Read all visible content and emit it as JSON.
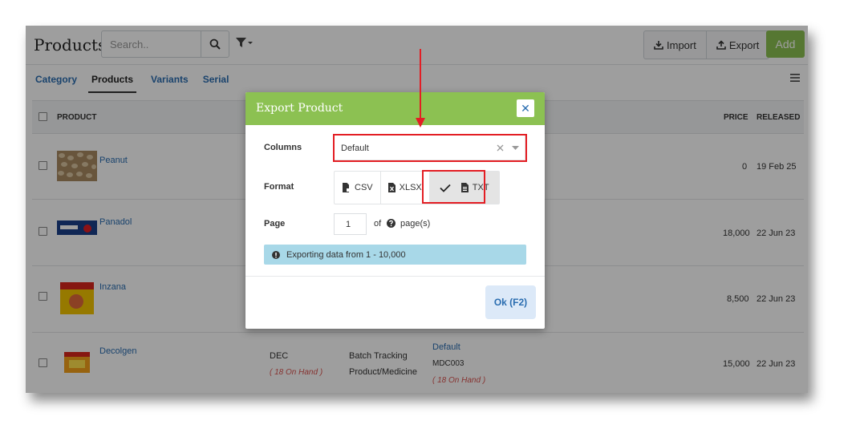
{
  "header": {
    "title": "Products",
    "search_placeholder": "Search..",
    "import_label": "Import",
    "export_label": "Export",
    "add_label": "Add"
  },
  "tabs": [
    {
      "label": "Category",
      "active": false
    },
    {
      "label": "Products",
      "active": true
    },
    {
      "label": "Variants",
      "active": false
    },
    {
      "label": "Serial",
      "active": false
    }
  ],
  "table": {
    "columns": {
      "product": "PRODUCT",
      "price": "PRICE",
      "released": "RELEASED"
    },
    "rows": [
      {
        "name": "Peanut",
        "price": "0",
        "released": "19 Feb 25"
      },
      {
        "name": "Panadol",
        "price": "18,000",
        "released": "22 Jun 23"
      },
      {
        "name": "Inzana",
        "price": "8,500",
        "released": "22 Jun 23"
      },
      {
        "name": "Decolgen",
        "code": "DEC",
        "stock": "( 18 On Hand )",
        "tracking": "Batch Tracking",
        "type": "Product/Medicine",
        "variant": "Default",
        "variant_code": "MDC003",
        "variant_stock": "( 18 On Hand )",
        "price": "15,000",
        "released": "22 Jun 23"
      }
    ]
  },
  "dialog": {
    "title": "Export Product",
    "close_label": "✕",
    "columns_label": "Columns",
    "columns_value": "Default",
    "format_label": "Format",
    "formats": [
      {
        "label": "CSV",
        "selected": false
      },
      {
        "label": "XLSX",
        "selected": false
      },
      {
        "label": "TXT",
        "selected": true
      }
    ],
    "page_label": "Page",
    "page_value": "1",
    "of_label": "of",
    "pages_label": "page(s)",
    "info_text": "Exporting data from 1 - 10,000",
    "ok_label": "Ok (F2)"
  },
  "colors": {
    "accent_green": "#8cc152",
    "link_blue": "#2a6db0",
    "highlight_red": "#e31e24",
    "info_blue": "#a8d8e8"
  }
}
